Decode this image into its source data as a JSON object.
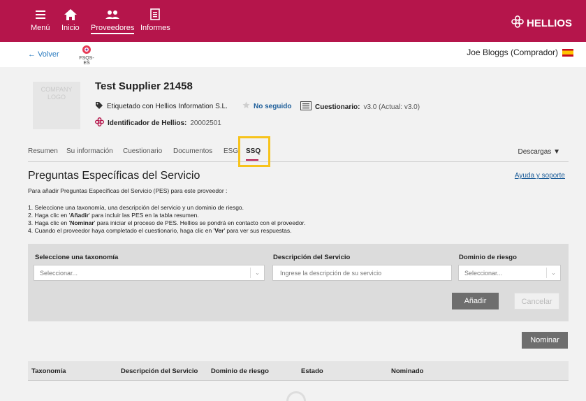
{
  "nav": {
    "items": [
      {
        "label": "Menú",
        "icon": "menu-icon"
      },
      {
        "label": "Inicio",
        "icon": "home-icon"
      },
      {
        "label": "Proveedores",
        "icon": "users-icon"
      },
      {
        "label": "Informes",
        "icon": "report-icon"
      }
    ],
    "brand": "HELLIOS"
  },
  "subheader": {
    "back": "Volver",
    "fsqs": "FSQS-ES",
    "user": "Joe Bloggs (Comprador)"
  },
  "supplier": {
    "logo_text": "COMPANY LOGO",
    "name": "Test Supplier 21458",
    "tag": "Etiquetado con Hellios Information S.L.",
    "follow": "No seguido",
    "questionnaire_label": "Cuestionario:",
    "questionnaire_value": "v3.0 (Actual: v3.0)",
    "id_label": "Identificador de Hellios:",
    "id_value": "20002501"
  },
  "tabs": {
    "items": [
      "Resumen",
      "Su información",
      "Cuestionario",
      "Documentos",
      "ESG",
      "SSQ"
    ],
    "downloads": "Descargas"
  },
  "section": {
    "title": "Preguntas Específicas del Servicio",
    "help": "Ayuda y soporte",
    "intro": "Para añadir Preguntas Específicas del Servicio (PES) para este proveedor :",
    "steps": [
      {
        "pre": "1. Seleccione una taxonomía, una descripción del servicio y un dominio de riesgo.",
        "bold": "",
        "post": ""
      },
      {
        "pre": "2. Haga clic en '",
        "bold": "Añadir",
        "post": "' para incluir las PES en la tabla resumen."
      },
      {
        "pre": "3. Haga clic en '",
        "bold": "Nominar",
        "post": "' para iniciar el proceso de PES. Hellios se pondrá en contacto con el proveedor."
      },
      {
        "pre": "4. Cuando el proveedor haya completado el cuestionario, haga clic en '",
        "bold": "Ver",
        "post": "' para ver sus respuestas."
      }
    ]
  },
  "form": {
    "taxonomy_label": "Seleccione una taxonomía",
    "taxonomy_placeholder": "Seleccionar...",
    "description_label": "Descripción del Servicio",
    "description_placeholder": "Ingrese la descripción de su servicio",
    "risk_label": "Dominio de riesgo",
    "risk_placeholder": "Seleccionar...",
    "add": "Añadir",
    "cancel": "Cancelar"
  },
  "nominate": "Nominar",
  "table": {
    "headers": [
      "Taxonomía",
      "Descripción del Servicio",
      "Dominio de riesgo",
      "Estado",
      "Nominado"
    ]
  },
  "colors": {
    "brand": "#b5154b",
    "highlight": "#f7c31b",
    "link": "#1c5d99"
  }
}
